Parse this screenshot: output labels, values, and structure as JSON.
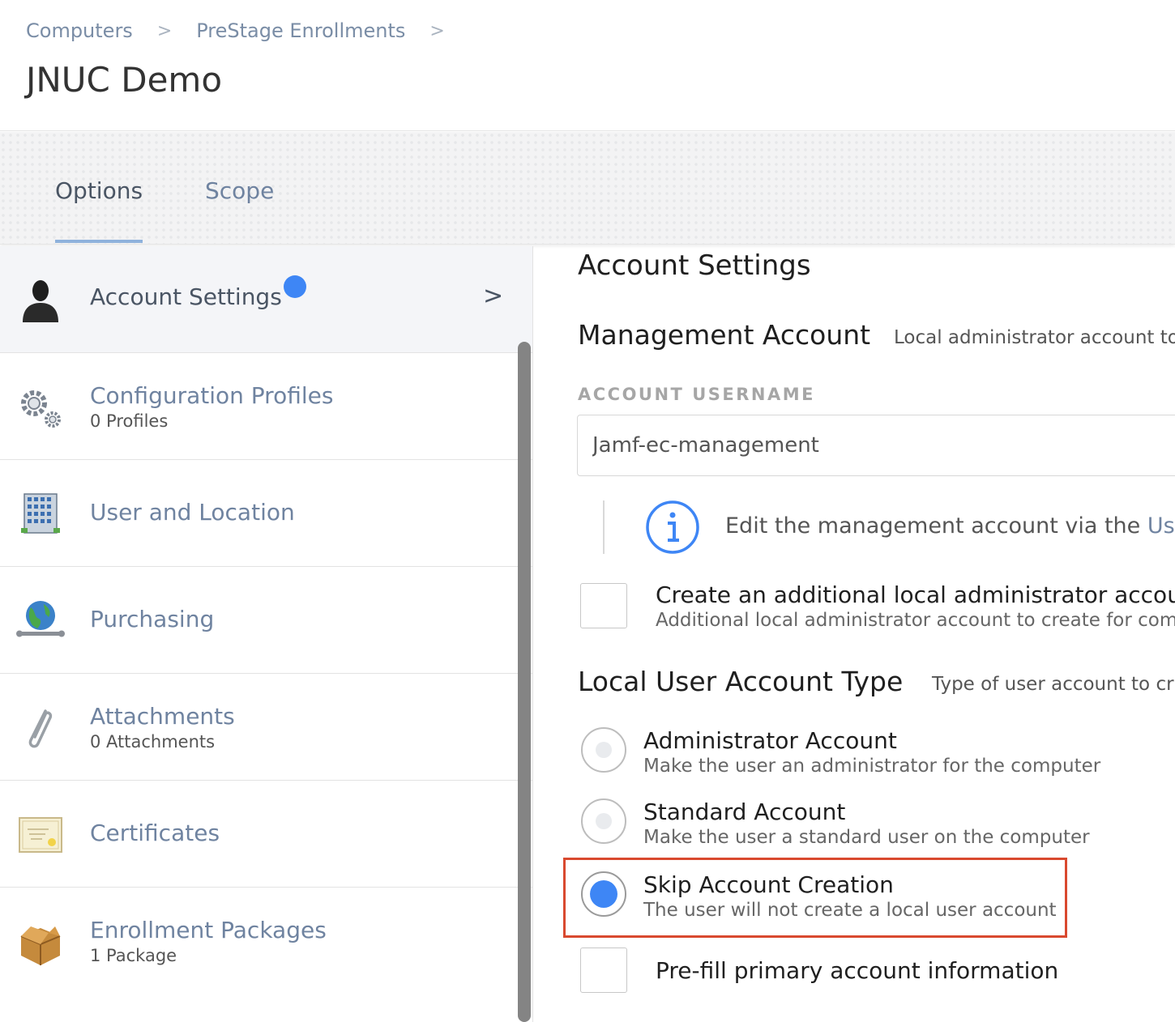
{
  "breadcrumb": {
    "items": [
      "Computers",
      "PreStage Enrollments"
    ],
    "separator": ">"
  },
  "page_title": "JNUC Demo",
  "tabs": [
    {
      "label": "Options",
      "active": true
    },
    {
      "label": "Scope",
      "active": false
    }
  ],
  "sidebar": {
    "items": [
      {
        "title": "Account Settings",
        "subtitle": "",
        "icon": "user-silhouette-icon",
        "active": true,
        "badge": true
      },
      {
        "title": "Configuration Profiles",
        "subtitle": "0 Profiles",
        "icon": "gears-icon"
      },
      {
        "title": "User and Location",
        "subtitle": "",
        "icon": "building-icon"
      },
      {
        "title": "Purchasing",
        "subtitle": "",
        "icon": "globe-wrench-icon"
      },
      {
        "title": "Attachments",
        "subtitle": "0 Attachments",
        "icon": "paperclip-icon"
      },
      {
        "title": "Certificates",
        "subtitle": "",
        "icon": "certificate-icon"
      },
      {
        "title": "Enrollment Packages",
        "subtitle": "1 Package",
        "icon": "package-box-icon"
      }
    ],
    "chevron": ">"
  },
  "main": {
    "section_title": "Account Settings",
    "management": {
      "title": "Management Account",
      "description": "Local administrator account to",
      "username_label": "ACCOUNT USERNAME",
      "username_value": "Jamf-ec-management",
      "info_text": "Edit the management account via the ",
      "info_link": "Use"
    },
    "additional_admin": {
      "title": "Create an additional local administrator account",
      "description": "Additional local administrator account to create for com",
      "checked": false
    },
    "local_user": {
      "title": "Local User Account Type",
      "description": "Type of user account to cr",
      "options": [
        {
          "title": "Administrator Account",
          "description": "Make the user an administrator for the computer",
          "selected": false
        },
        {
          "title": "Standard Account",
          "description": "Make the user a standard user on the computer",
          "selected": false
        },
        {
          "title": "Skip Account Creation",
          "description": "The user will not create a local user account",
          "selected": true
        }
      ]
    },
    "prefill": {
      "title": "Pre-fill primary account information",
      "checked": false
    }
  },
  "colors": {
    "accent_blue": "#3e86f5",
    "link_blue": "#6f83a0",
    "highlight_red": "#d9492f"
  }
}
